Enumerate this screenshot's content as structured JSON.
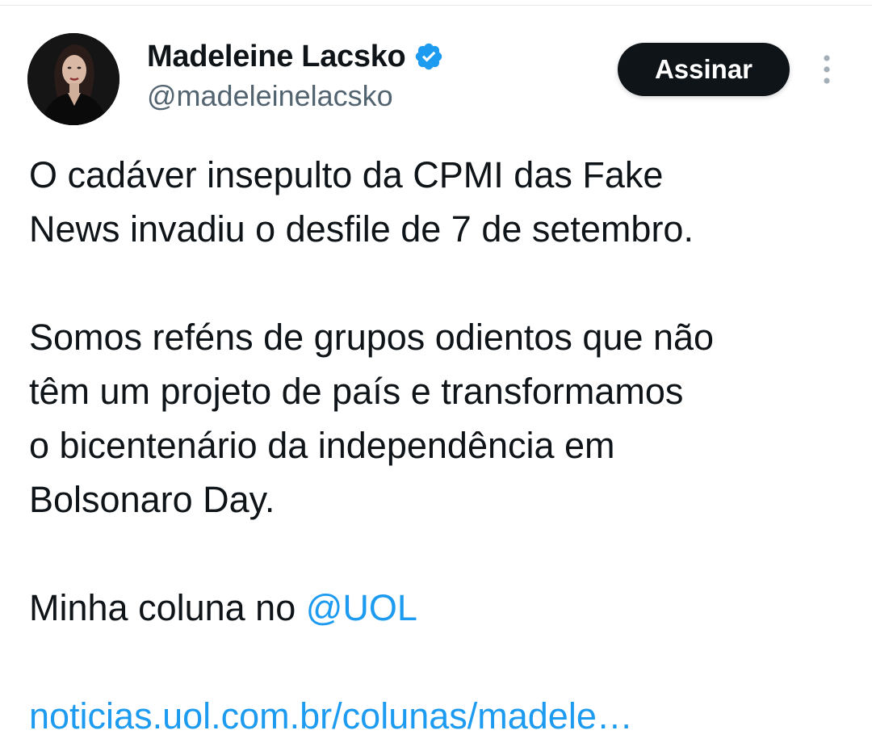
{
  "author": {
    "display_name": "Madeleine Lacsko",
    "handle": "@madeleinelacsko",
    "verified": true
  },
  "actions": {
    "subscribe_label": "Assinar"
  },
  "tweet": {
    "paragraph_1": [
      "O cadáver insepulto da CPMI das Fake",
      "News invadiu o desfile de 7 de setembro."
    ],
    "paragraph_2": [
      "Somos reféns de grupos odientos que não",
      "têm um projeto de país e transformamos",
      "o bicentenário da independência em",
      "Bolsonaro Day."
    ],
    "paragraph_3_text": "Minha coluna no ",
    "mention": "@UOL",
    "link_text": "noticias.uol.com.br/colunas/madele…"
  },
  "colors": {
    "text": "#0f1419",
    "secondary": "#536471",
    "accent": "#1d9bf0",
    "button_bg": "#0f1419"
  },
  "icons": {
    "verified": "verified-badge-icon",
    "more": "more-vertical-icon"
  }
}
